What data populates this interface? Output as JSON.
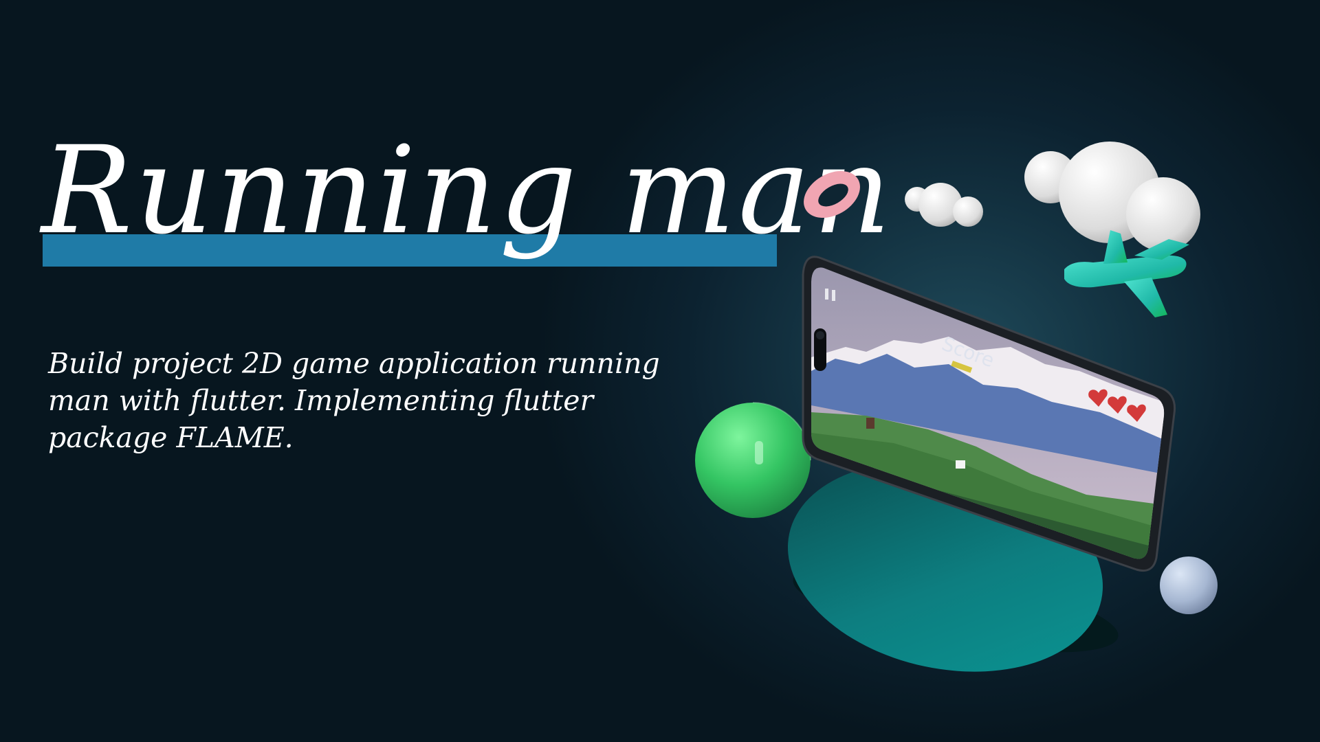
{
  "slide": {
    "title": "Running man",
    "description": "Build project 2D game application running man with flutter. Implementing flutter package FLAME.",
    "accent_color": "#1f7ba7",
    "background_color": "#07161f"
  },
  "phone_screen": {
    "score_label": "Score",
    "lives": 3,
    "icons": [
      "pause-icon",
      "heart-icon",
      "heart-icon",
      "heart-icon"
    ]
  },
  "decorations": [
    "pink-torus",
    "small-cloud",
    "large-cloud",
    "airplane",
    "green-sphere",
    "blue-sphere",
    "teal-pedestal"
  ]
}
